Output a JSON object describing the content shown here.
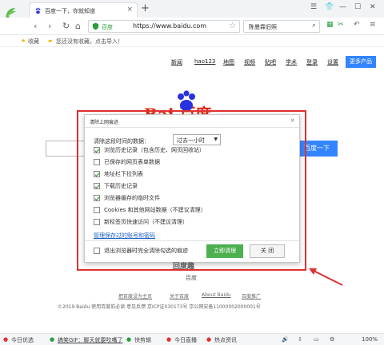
{
  "tab": {
    "title": "百度一下，你就知道"
  },
  "address": {
    "site_label": "百度",
    "url": "https://www.baidu.com"
  },
  "search_box": {
    "text": "陈曼霖旧照"
  },
  "bookmarks": {
    "fav_label": "收藏",
    "hint": "您还没有收藏，点击导入！"
  },
  "baidu_nav": [
    "新闻",
    "hao123",
    "地图",
    "视频",
    "贴吧",
    "学术",
    "登录",
    "设置"
  ],
  "more_products": "更多产品",
  "logo_text": "Bai  百度",
  "search_button": "百度一下",
  "dialog": {
    "title": "清除上网痕迹",
    "range_label": "清除这段时间的数据：",
    "range_value": "过去一小时",
    "options": [
      {
        "label": "浏览历史记录（包含历史、网页回收站）",
        "checked": true
      },
      {
        "label": "已保存的网页表单数据",
        "checked": false
      },
      {
        "label": "地址栏下拉列表",
        "checked": true
      },
      {
        "label": "下载历史记录",
        "checked": true
      },
      {
        "label": "浏览器缓存的临时文件",
        "checked": true
      },
      {
        "label": "Cookies 和其他网站数据（不建议清理）",
        "checked": false
      },
      {
        "label": "新标签页快速访问（不建议清理）",
        "checked": false
      }
    ],
    "manage_link": "管理保存过的账号和密码",
    "exit_option": "退出浏览器时完全清除勾选的痕迹",
    "clear_button": "立即清理",
    "close_button": "关 闭"
  },
  "qr": {
    "title": "回度趣",
    "subtitle": "百度"
  },
  "footer_links": [
    "把百度设为主页",
    "关于百度",
    "About Baidu",
    "百度推广"
  ],
  "copyright": "©2019 Baidu 使用百度前必读 意见反馈 京ICP证030173号  京公网安备11000002000001号",
  "statusbar": [
    "今日优选",
    "搞笑GIF：聊天就要吹嘴了",
    "快剪辑",
    "今日直播",
    "热点资讯"
  ],
  "zoom": "100%",
  "colors": {
    "accent": "#3385ff",
    "dialog_border": "#e0302f",
    "clear_button": "#4caf50"
  }
}
